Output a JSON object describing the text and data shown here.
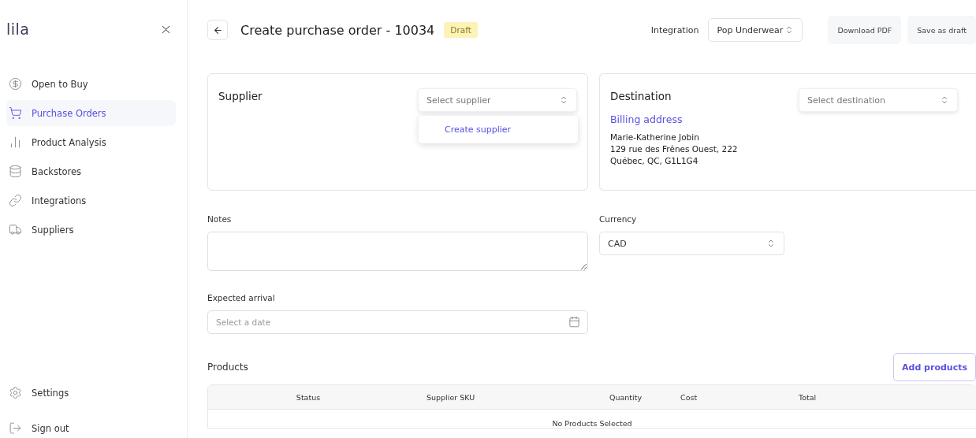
{
  "sidebar": {
    "logo": "lila",
    "items": [
      {
        "label": "Open to Buy",
        "selected": false
      },
      {
        "label": "Purchase Orders",
        "selected": true
      },
      {
        "label": "Product Analysis",
        "selected": false
      },
      {
        "label": "Backstores",
        "selected": false
      },
      {
        "label": "Integrations",
        "selected": false
      },
      {
        "label": "Suppliers",
        "selected": false
      }
    ],
    "footer_items": [
      "Settings",
      "Sign out"
    ]
  },
  "header": {
    "title": "Create purchase order - 10034",
    "status": "Draft",
    "integration_label": "Integration",
    "integration_value": "Pop Underwear",
    "buttons": [
      "Download PDF",
      "Save as draft"
    ]
  },
  "supplier": {
    "title": "Supplier",
    "placeholder": "Select supplier",
    "menu_items": [
      "Create supplier"
    ]
  },
  "destination": {
    "title": "Destination",
    "placeholder": "Select destination",
    "address_title": "Billing address",
    "address_lines": [
      "Marie-Katherine Jobin",
      "129 rue des Frênes Ouest, 222",
      "Québec, QC, G1L1G4"
    ]
  },
  "notes": {
    "label": "Notes"
  },
  "currency": {
    "label": "Currency",
    "value": "CAD"
  },
  "expected_arrival": {
    "label": "Expected arrival",
    "placeholder": "Select a date"
  },
  "products": {
    "title": "Products",
    "add_button": "Add products",
    "columns": [
      "Status",
      "Supplier SKU",
      "Quantity",
      "Cost",
      "Total"
    ],
    "empty_text": "No Products Selected"
  }
}
